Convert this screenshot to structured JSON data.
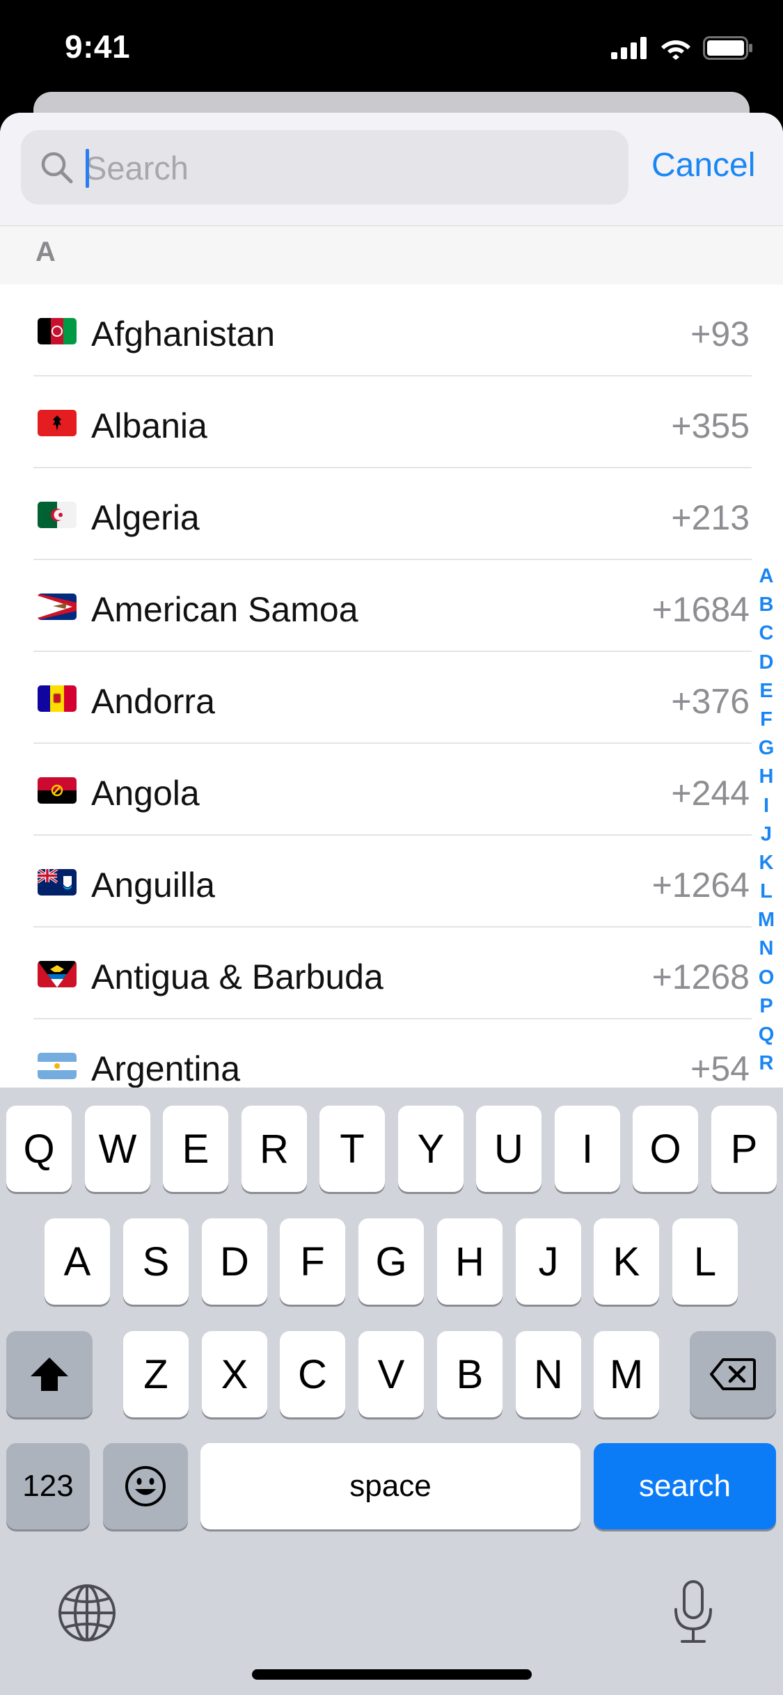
{
  "status_bar": {
    "time": "9:41",
    "icons": [
      "cellular-signal-icon",
      "wifi-icon",
      "battery-icon"
    ]
  },
  "search": {
    "placeholder": "Search",
    "value": "",
    "cancel_label": "Cancel"
  },
  "section": {
    "letter": "A"
  },
  "countries": [
    {
      "name": "Afghanistan",
      "code": "+93",
      "flag": "afghanistan-flag-icon"
    },
    {
      "name": "Albania",
      "code": "+355",
      "flag": "albania-flag-icon"
    },
    {
      "name": "Algeria",
      "code": "+213",
      "flag": "algeria-flag-icon"
    },
    {
      "name": "American Samoa",
      "code": "+1684",
      "flag": "american-samoa-flag-icon"
    },
    {
      "name": "Andorra",
      "code": "+376",
      "flag": "andorra-flag-icon"
    },
    {
      "name": "Angola",
      "code": "+244",
      "flag": "angola-flag-icon"
    },
    {
      "name": "Anguilla",
      "code": "+1264",
      "flag": "anguilla-flag-icon"
    },
    {
      "name": "Antigua & Barbuda",
      "code": "+1268",
      "flag": "antigua-barbuda-flag-icon"
    },
    {
      "name": "Argentina",
      "code": "+54",
      "flag": "argentina-flag-icon"
    }
  ],
  "index_letters": [
    "A",
    "B",
    "C",
    "D",
    "E",
    "F",
    "G",
    "H",
    "I",
    "J",
    "K",
    "L",
    "M",
    "N",
    "O",
    "P",
    "Q",
    "R"
  ],
  "keyboard": {
    "row1": [
      "Q",
      "W",
      "E",
      "R",
      "T",
      "Y",
      "U",
      "I",
      "O",
      "P"
    ],
    "row2": [
      "A",
      "S",
      "D",
      "F",
      "G",
      "H",
      "J",
      "K",
      "L"
    ],
    "row3": [
      "Z",
      "X",
      "C",
      "V",
      "B",
      "N",
      "M"
    ],
    "numbers_label": "123",
    "space_label": "space",
    "search_label": "search",
    "icons": [
      "shift-icon",
      "backspace-icon",
      "emoji-icon",
      "globe-icon",
      "microphone-icon"
    ]
  },
  "colors": {
    "accent": "#1a86f3",
    "search_key": "#0b7bf6",
    "keyboard_bg": "#d1d4db"
  }
}
